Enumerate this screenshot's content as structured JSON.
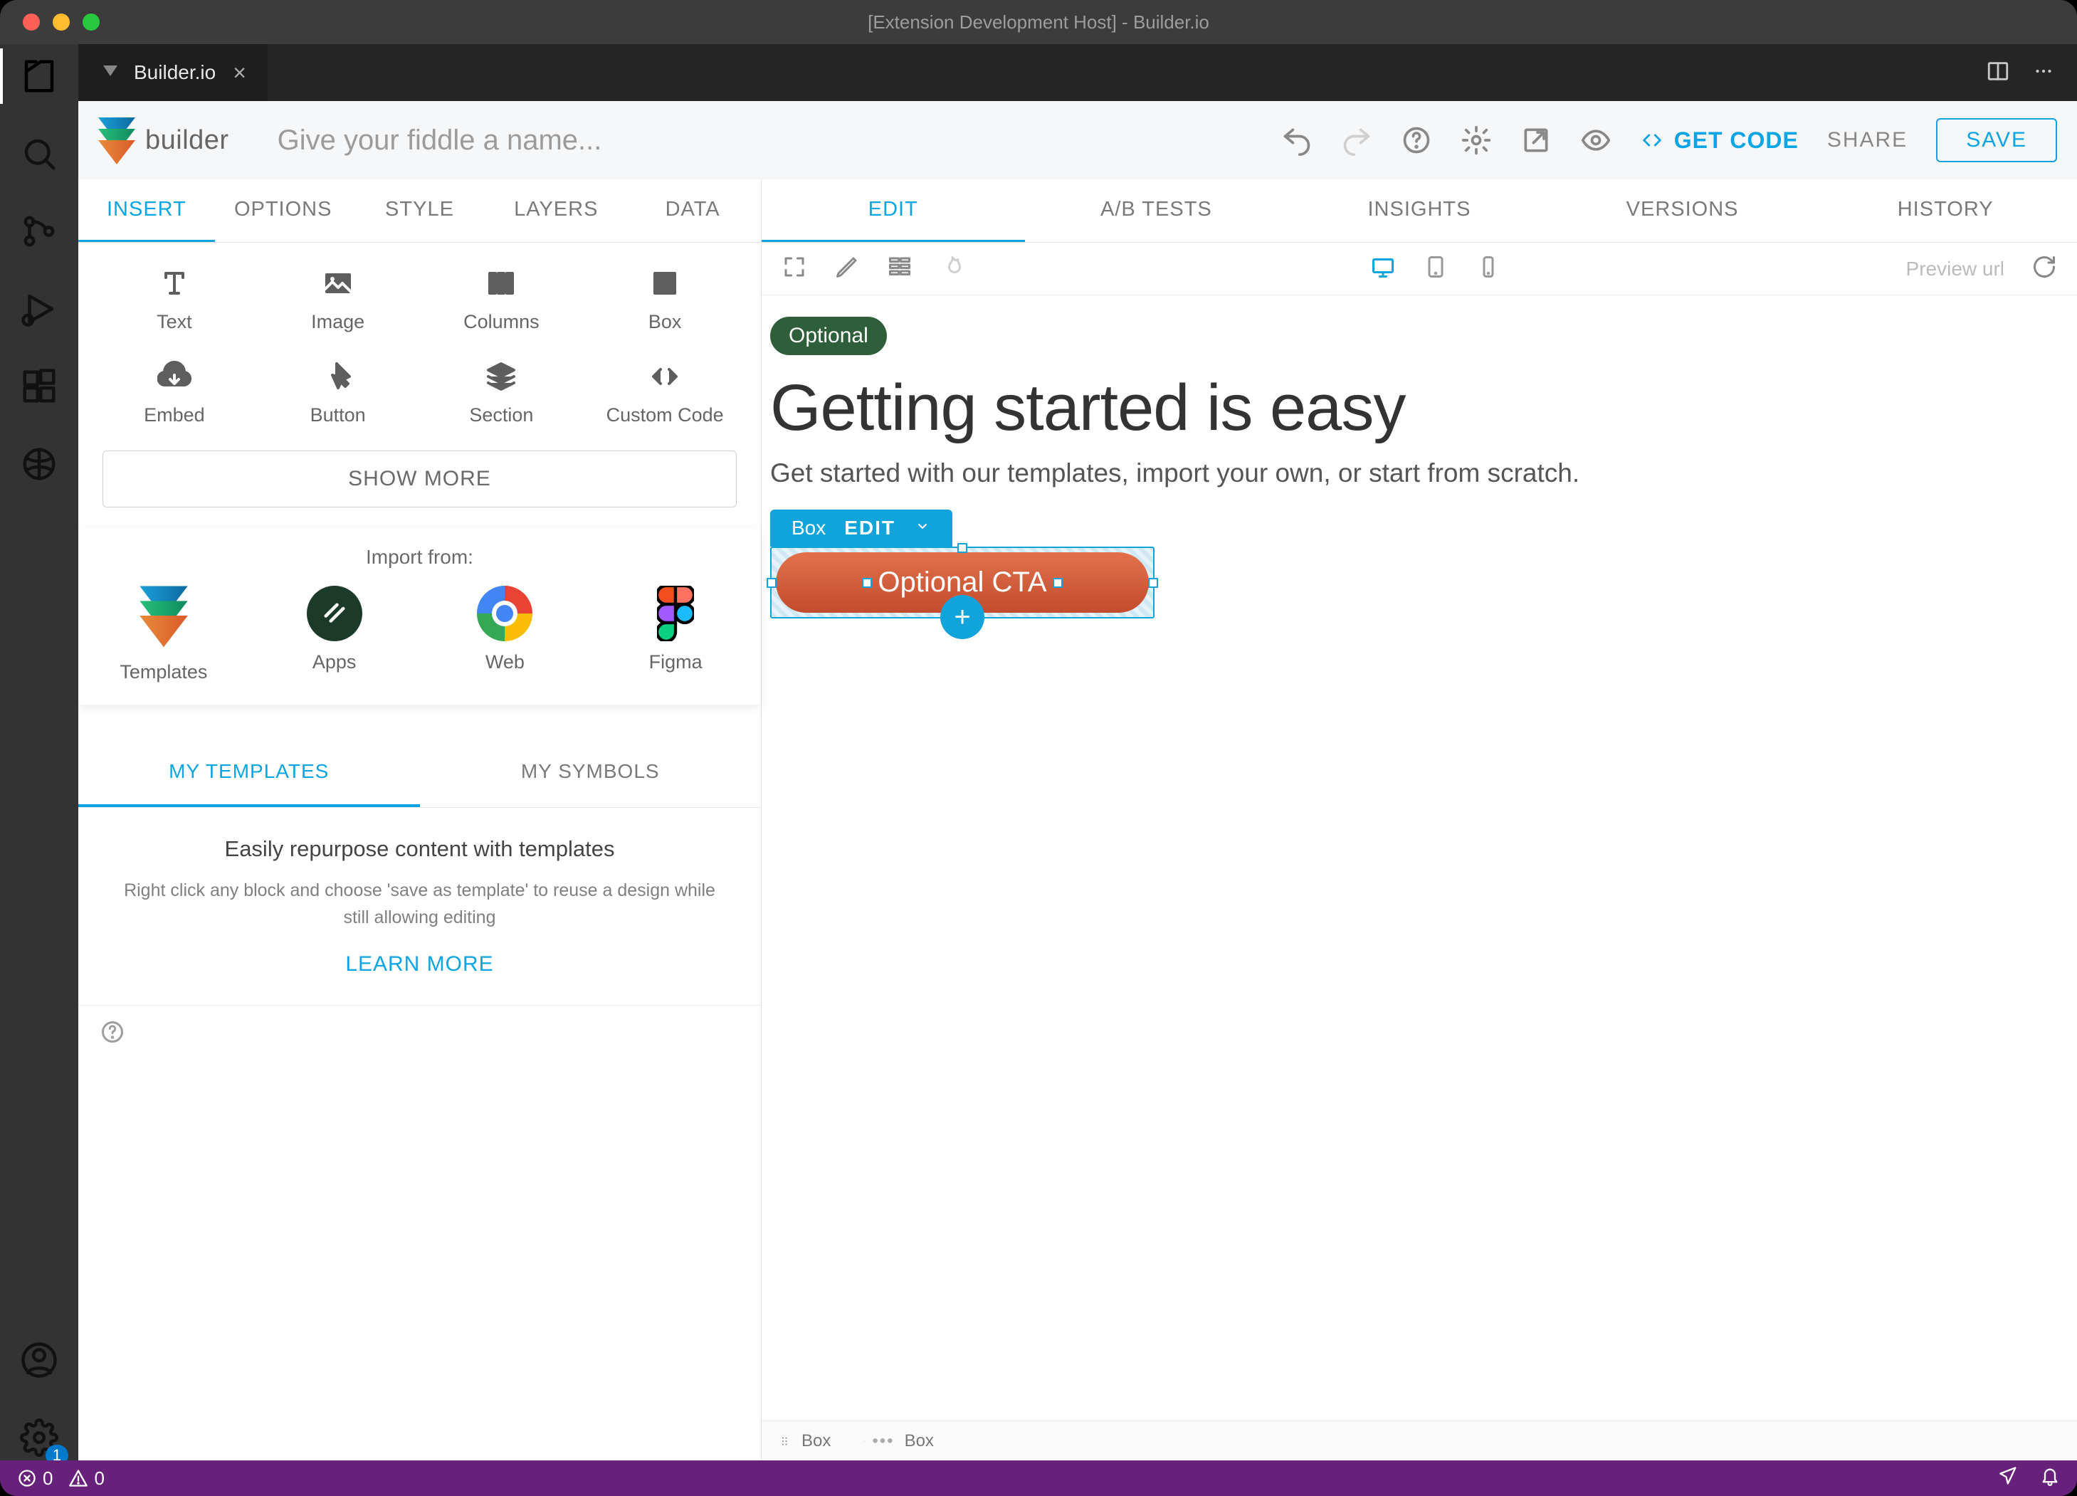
{
  "window": {
    "title": "[Extension Development Host] - Builder.io",
    "tab_title": "Builder.io"
  },
  "activitybar": {
    "gear_badge": "1"
  },
  "builder": {
    "brand": "builder",
    "name_placeholder": "Give your fiddle a name...",
    "actions": {
      "getcode": "GET CODE",
      "share": "SHARE",
      "save": "SAVE"
    },
    "left_tabs": [
      "INSERT",
      "OPTIONS",
      "STYLE",
      "LAYERS",
      "DATA"
    ],
    "insert_items": [
      "Text",
      "Image",
      "Columns",
      "Box",
      "Embed",
      "Button",
      "Section",
      "Custom Code"
    ],
    "show_more": "SHOW MORE",
    "import_from": "Import from:",
    "import_items": [
      "Templates",
      "Apps",
      "Web",
      "Figma"
    ],
    "subtabs": [
      "MY TEMPLATES",
      "MY SYMBOLS"
    ],
    "templates_card": {
      "title": "Easily repurpose content with templates",
      "body": "Right click any block and choose 'save as template' to reuse a design while still allowing editing",
      "learn": "LEARN MORE"
    },
    "right_tabs": [
      "EDIT",
      "A/B TESTS",
      "INSIGHTS",
      "VERSIONS",
      "HISTORY"
    ],
    "preview_placeholder": "Preview url",
    "canvas": {
      "badge": "Optional",
      "headline": "Getting started is easy",
      "subhead": "Get started with our templates, import your own, or start from scratch.",
      "sel_type": "Box",
      "sel_action": "EDIT",
      "cta": "Optional CTA"
    },
    "breadcrumbs": [
      "Box",
      "Box"
    ]
  },
  "statusbar": {
    "errors": "0",
    "warnings": "0"
  }
}
